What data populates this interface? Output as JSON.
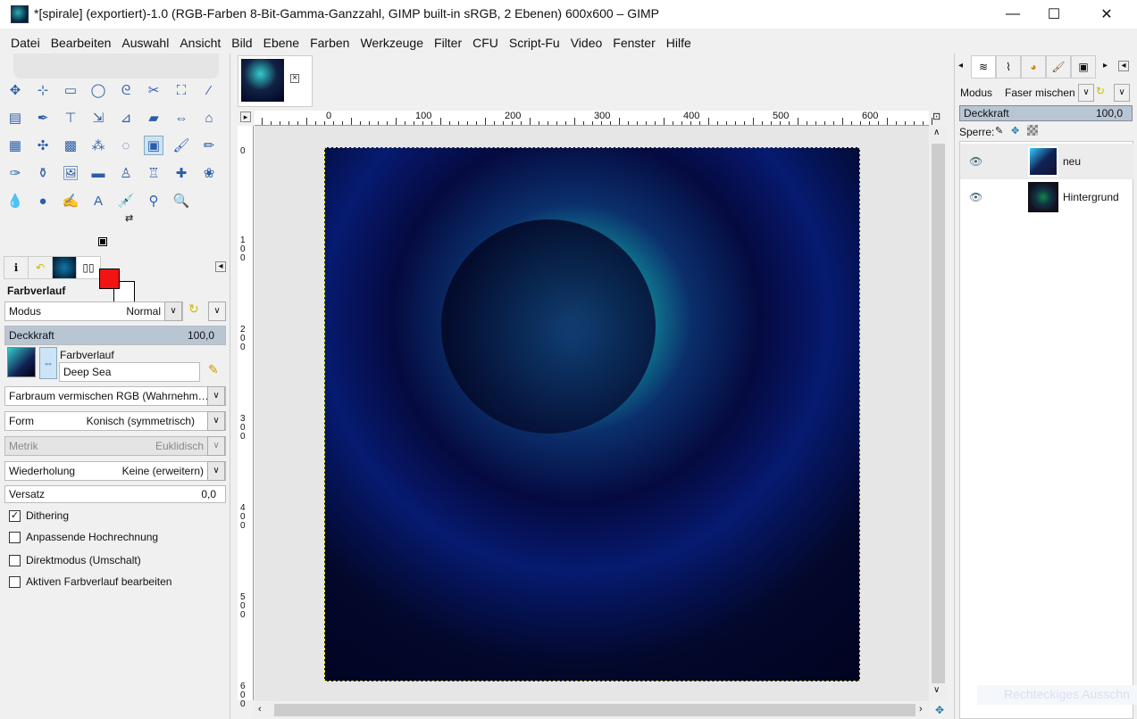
{
  "window": {
    "title": "*[spirale] (exportiert)-1.0 (RGB-Farben 8-Bit-Gamma-Ganzzahl, GIMP built-in sRGB, 2 Ebenen) 600x600 – GIMP",
    "minimize": "—",
    "maximize": "☐",
    "close": "✕"
  },
  "menu": [
    "Datei",
    "Bearbeiten",
    "Auswahl",
    "Ansicht",
    "Bild",
    "Ebene",
    "Farben",
    "Werkzeuge",
    "Filter",
    "CFU",
    "Script-Fu",
    "Video",
    "Fenster",
    "Hilfe"
  ],
  "tools": [
    "✥",
    "⊹",
    "▭",
    "◯",
    "ᘓ",
    "✂",
    "⛶",
    "⁄",
    "▤",
    "✒",
    "⊤",
    "⇲",
    "⊿",
    "▰",
    "⇔",
    "⌂",
    "▦",
    "✣",
    "▩",
    "⁂",
    "◌",
    "▣",
    "🖌",
    "✏",
    "✑",
    "⚱",
    "🖼",
    "▬",
    "♙",
    "♖",
    "✚",
    "❀",
    "💧",
    "●",
    "✍",
    "A",
    "💉",
    "⚲",
    "🔍"
  ],
  "tool_options": {
    "title": "Farbverlauf",
    "mode_label": "Modus",
    "mode_value": "Normal",
    "opacity_label": "Deckkraft",
    "opacity_value": "100,0",
    "gradient_label": "Farbverlauf",
    "gradient_value": "Deep Sea",
    "blend_space": "Farbraum vermischen RGB (Wahrnehm…",
    "shape_label": "Form",
    "shape_value": "Konisch (symmetrisch)",
    "metric_label": "Metrik",
    "metric_value": "Euklidisch",
    "repeat_label": "Wiederholung",
    "repeat_value": "Keine (erweitern)",
    "offset_label": "Versatz",
    "offset_value": "0,0",
    "checkboxes": [
      {
        "label": "Dithering",
        "checked": true
      },
      {
        "label": "Anpassende Hochrechnung",
        "checked": false
      },
      {
        "label": "Direktmodus (Umschalt)",
        "checked": false
      },
      {
        "label": "Aktiven Farbverlauf bearbeiten",
        "checked": false
      }
    ]
  },
  "colors": {
    "foreground": "#f01414",
    "background": "#ffffff"
  },
  "ruler": {
    "h": [
      "0",
      "100",
      "200",
      "300",
      "400",
      "500",
      "600"
    ],
    "v": [
      "0",
      "100",
      "200",
      "300",
      "400",
      "500",
      "600"
    ]
  },
  "layers_panel": {
    "mode_label": "Modus",
    "mode_value": "Faser mischen",
    "opacity_label": "Deckkraft",
    "opacity_value": "100,0",
    "lock_label": "Sperre:",
    "layers": [
      {
        "name": "neu",
        "visible": true,
        "selected": true
      },
      {
        "name": "Hintergrund",
        "visible": true,
        "selected": false
      }
    ]
  },
  "status_ghost": "Rechteckiges Ausschn"
}
